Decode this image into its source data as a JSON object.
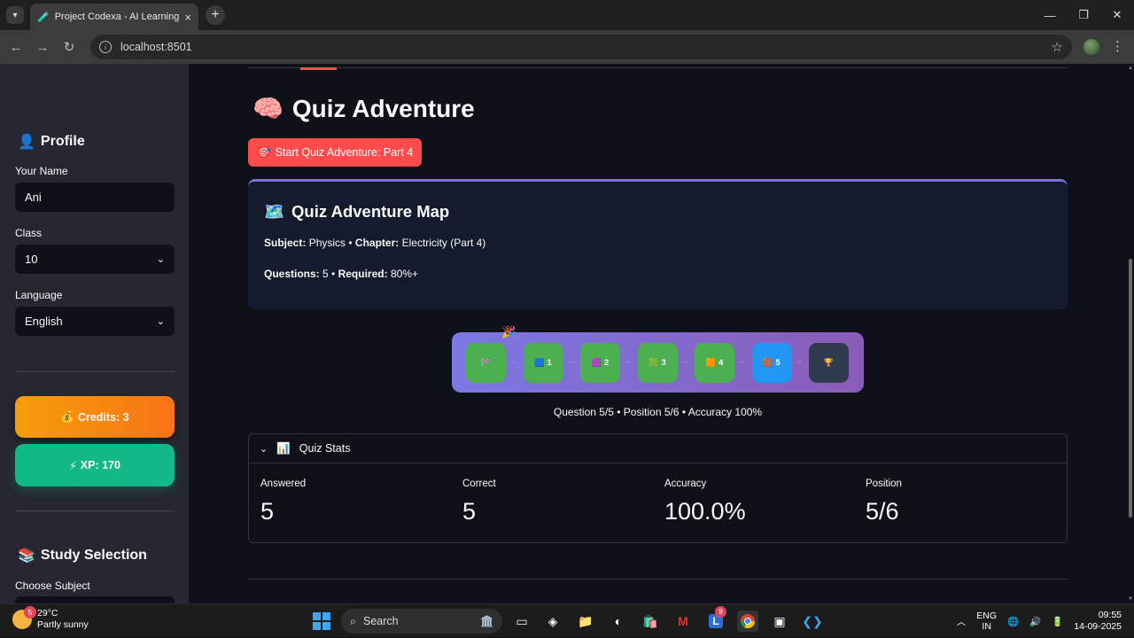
{
  "browser": {
    "tab_title": "Project Codexa - AI Learning Pl",
    "url": "localhost:8501"
  },
  "sidebar": {
    "profile_heading": "Profile",
    "name_label": "Your Name",
    "name_value": "Ani",
    "class_label": "Class",
    "class_value": "10",
    "language_label": "Language",
    "language_value": "English",
    "credits": "Credits: 3",
    "xp": "XP: 170",
    "study_heading": "Study Selection",
    "subject_label": "Choose Subject"
  },
  "main": {
    "title": "Quiz Adventure",
    "start_button": "Start Quiz Adventure: Part 4",
    "map": {
      "title": "Quiz Adventure Map",
      "subject_label": "Subject:",
      "subject_value": "Physics",
      "chapter_label": "Chapter:",
      "chapter_value": "Electricity (Part 4)",
      "questions_label": "Questions:",
      "questions_value": "5",
      "required_label": "Required:",
      "required_value": "80%+"
    },
    "nodes": [
      {
        "label": "",
        "glyph": "🏁",
        "color": "#4caf50"
      },
      {
        "label": "1",
        "glyph": "🟦",
        "color": "#4caf50"
      },
      {
        "label": "2",
        "glyph": "🟪",
        "color": "#4caf50"
      },
      {
        "label": "3",
        "glyph": "🟩",
        "color": "#4caf50"
      },
      {
        "label": "4",
        "glyph": "🟧",
        "color": "#4caf50"
      },
      {
        "label": "5",
        "glyph": "🟫",
        "color": "#2196f3"
      },
      {
        "label": "",
        "glyph": "🏆",
        "color": "#2f3a4e"
      }
    ],
    "progress_text": "Question 5/5 • Position 5/6 • Accuracy 100%",
    "stats": {
      "title": "Quiz Stats",
      "metrics": [
        {
          "label": "Answered",
          "value": "5"
        },
        {
          "label": "Correct",
          "value": "5"
        },
        {
          "label": "Accuracy",
          "value": "100.0%"
        },
        {
          "label": "Position",
          "value": "5/6"
        }
      ]
    }
  },
  "taskbar": {
    "weather_temp": "29°C",
    "weather_desc": "Partly sunny",
    "weather_badge": "5",
    "search": "Search",
    "lang_top": "ENG",
    "lang_bottom": "IN",
    "time": "09:55",
    "date": "14-09-2025",
    "l_badge": "9"
  }
}
